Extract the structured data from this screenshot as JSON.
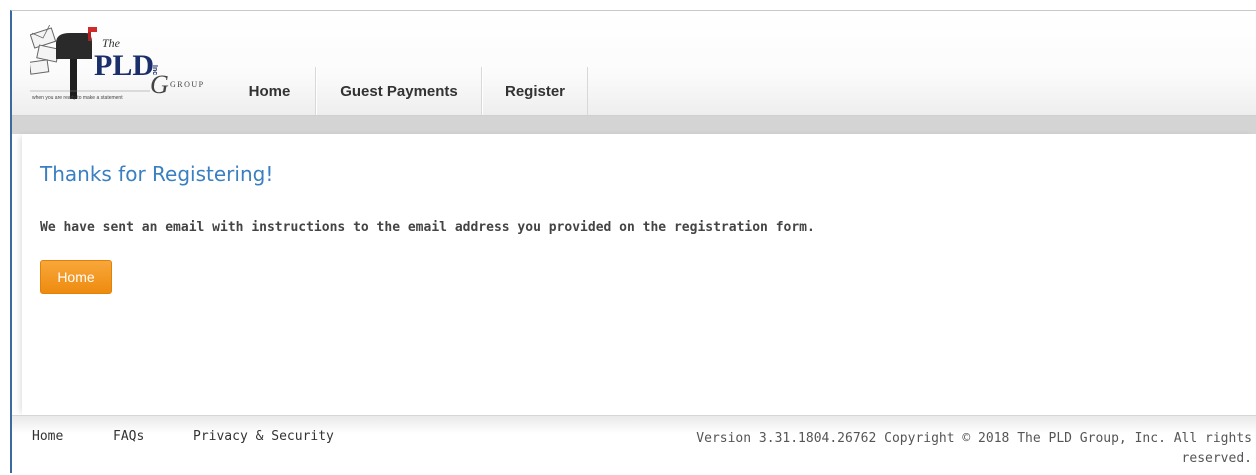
{
  "header": {
    "logo": {
      "brand_small": "The",
      "brand_main": "PLD",
      "brand_suffix": "Inc",
      "brand_group": "GROUP",
      "tagline": "when you are ready to make a statement"
    },
    "nav": [
      {
        "label": "Home"
      },
      {
        "label": "Guest Payments"
      },
      {
        "label": "Register"
      }
    ]
  },
  "main": {
    "title": "Thanks for Registering!",
    "message": "We have sent an email with instructions to the email address you provided on the registration form.",
    "home_button": "Home"
  },
  "footer": {
    "links": [
      {
        "label": "Home"
      },
      {
        "label": "FAQs"
      },
      {
        "label": "Privacy & Security"
      }
    ],
    "copyright": "Version 3.31.1804.26762 Copyright © 2018 The PLD Group, Inc. All rights reserved."
  },
  "colors": {
    "title_blue": "#3a7fc1",
    "button_orange": "#f39a1e",
    "frame_blue": "#3b6aa0"
  }
}
